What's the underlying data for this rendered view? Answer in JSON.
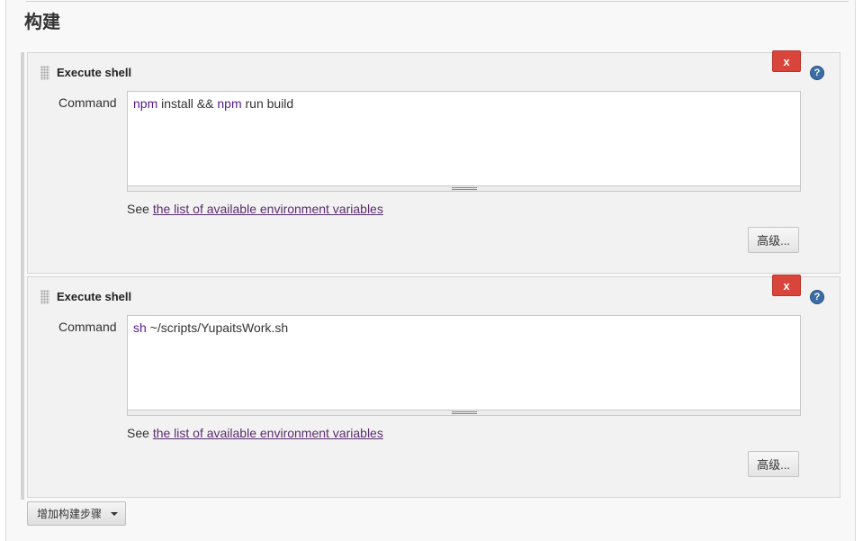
{
  "section": {
    "title": "构建"
  },
  "steps": [
    {
      "title": "Execute shell",
      "delete_label": "x",
      "help_label": "?",
      "command_label": "Command",
      "command_keyword": "npm",
      "command_part1": " install && ",
      "command_keyword2": "npm",
      "command_part2": " run build",
      "env_prefix": "See ",
      "env_link": "the list of available environment variables",
      "advanced_label": "高级..."
    },
    {
      "title": "Execute shell",
      "delete_label": "x",
      "help_label": "?",
      "command_label": "Command",
      "command_keyword": "sh",
      "command_part1": " ~/scripts/YupaitsWork.sh",
      "env_prefix": "See ",
      "env_link": "the list of available environment variables",
      "advanced_label": "高级..."
    }
  ],
  "add_step": {
    "label": "增加构建步骤"
  },
  "colors": {
    "delete_button": "#d9453a",
    "help_icon": "#3c6ea6",
    "link": "#5a2d6e",
    "keyword": "#551a8b"
  }
}
